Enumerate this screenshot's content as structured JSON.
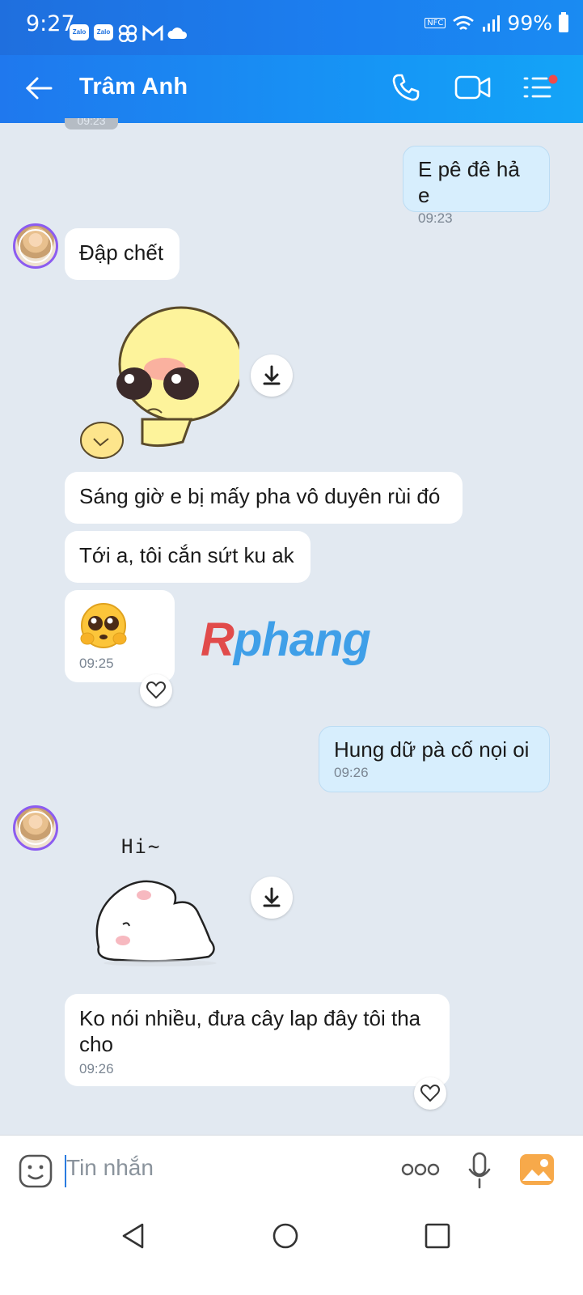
{
  "status_bar": {
    "time": "9:27",
    "app_badge_1": "Zalo",
    "app_badge_2": "Zalo",
    "nfc": "NFC",
    "battery": "99%"
  },
  "header": {
    "title": "Trâm Anh",
    "back_icon": "arrow-left-icon",
    "call_icon": "phone-icon",
    "video_icon": "video-icon",
    "menu_icon": "menu-list-icon"
  },
  "messages": [
    {
      "side": "top-peek",
      "time": "09:23"
    },
    {
      "side": "me",
      "text": "E pê đê hả e",
      "time": "09:23"
    },
    {
      "side": "them",
      "text": "Đập chết"
    },
    {
      "side": "them",
      "sticker": "yellow-chick-sticker"
    },
    {
      "side": "them",
      "text": "Sáng giờ e bị mấy pha vô duyên rùi đó"
    },
    {
      "side": "them",
      "text": "Tới a, tôi cắn sứt ku ak"
    },
    {
      "side": "them",
      "emoji": "pleading-face",
      "time": "09:25"
    },
    {
      "side": "me",
      "text": "Hung dữ pà cố nọi oi",
      "time": "09:26"
    },
    {
      "side": "them",
      "sticker": "hi-bunny-sticker",
      "sticker_text": "Hi~"
    },
    {
      "side": "them",
      "text": "Ko nói nhiều, đưa cây lap đây tôi tha cho",
      "time": "09:26"
    }
  ],
  "watermark": "Rphang",
  "composer": {
    "placeholder": "Tin nhắn"
  },
  "colors": {
    "header": "#1b7ff0",
    "my_bubble": "#d7eefd",
    "chat_bg": "#e2e9f1"
  }
}
